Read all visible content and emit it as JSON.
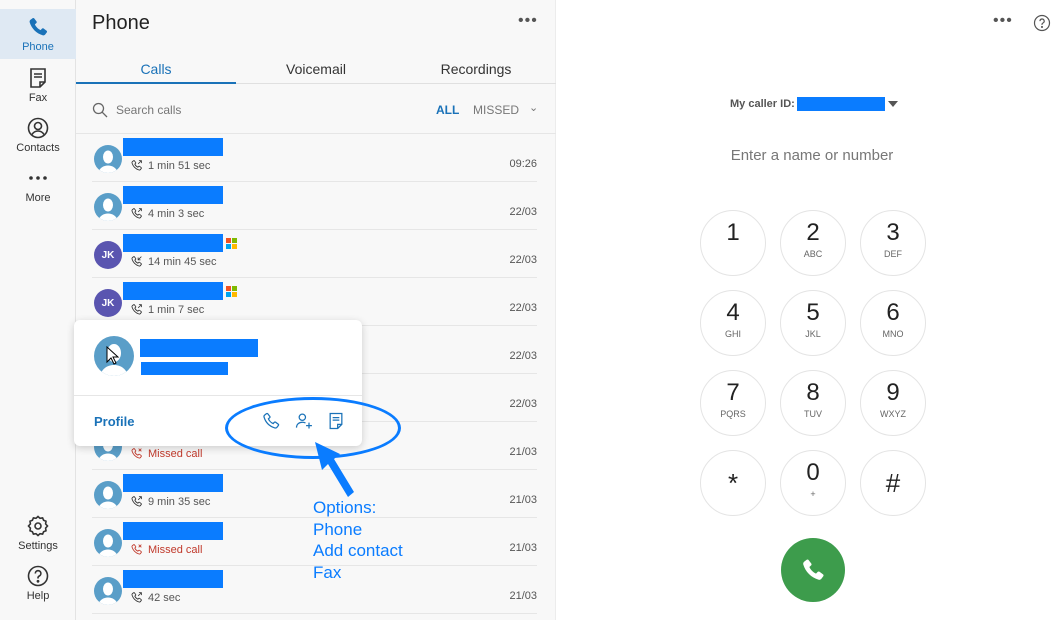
{
  "sidebar": {
    "items": [
      {
        "label": "Phone",
        "icon": "phone-icon",
        "active": true
      },
      {
        "label": "Fax",
        "icon": "fax-icon"
      },
      {
        "label": "Contacts",
        "icon": "contacts-icon"
      },
      {
        "label": "More",
        "icon": "more-icon"
      }
    ],
    "bottom_items": [
      {
        "label": "Settings",
        "icon": "gear-icon"
      },
      {
        "label": "Help",
        "icon": "help-icon"
      }
    ]
  },
  "panel": {
    "title": "Phone",
    "more_label": "•••",
    "tabs": [
      {
        "label": "Calls",
        "active": true
      },
      {
        "label": "Voicemail"
      },
      {
        "label": "Recordings"
      }
    ],
    "search": {
      "placeholder": "Search calls",
      "value": ""
    },
    "filters": {
      "all": "ALL",
      "missed": "MISSED",
      "chevron": "⌄"
    },
    "calls": [
      {
        "avatar": "generic",
        "direction": "outgoing",
        "meta": "1 min 51 sec",
        "time": "09:26"
      },
      {
        "avatar": "generic",
        "direction": "outgoing",
        "meta": "4 min 3 sec",
        "time": "22/03"
      },
      {
        "avatar": "initials",
        "initials": "JK",
        "ms_badge": true,
        "direction": "incoming",
        "meta": "14 min 45 sec",
        "time": "22/03"
      },
      {
        "avatar": "initials",
        "initials": "JK",
        "ms_badge": true,
        "direction": "outgoing",
        "meta": "1 min 7 sec",
        "time": "22/03"
      },
      {
        "avatar": "generic",
        "direction": "outgoing",
        "meta": "",
        "time": "22/03"
      },
      {
        "avatar": "generic",
        "direction": "outgoing",
        "meta": "",
        "time": "22/03"
      },
      {
        "avatar": "generic",
        "direction": "missed",
        "meta": "Missed call",
        "time": "21/03"
      },
      {
        "avatar": "generic",
        "direction": "outgoing",
        "meta": "9 min 35 sec",
        "time": "21/03"
      },
      {
        "avatar": "generic",
        "direction": "missed",
        "meta": "Missed call",
        "time": "21/03"
      },
      {
        "avatar": "generic",
        "direction": "outgoing",
        "meta": "42 sec",
        "time": "21/03"
      }
    ]
  },
  "popover": {
    "profile_label": "Profile",
    "actions": [
      "phone-icon",
      "add-contact-icon",
      "fax-icon"
    ]
  },
  "annotation": {
    "lines": [
      "Options:",
      "Phone",
      "Add contact",
      "Fax"
    ],
    "color": "#0a7cff"
  },
  "dialer": {
    "more_label": "•••",
    "caller_id_label": "My caller ID:",
    "input": {
      "placeholder": "Enter a name or number",
      "value": ""
    },
    "keys": [
      {
        "digit": "1",
        "letters": ""
      },
      {
        "digit": "2",
        "letters": "ABC"
      },
      {
        "digit": "3",
        "letters": "DEF"
      },
      {
        "digit": "4",
        "letters": "GHI"
      },
      {
        "digit": "5",
        "letters": "JKL"
      },
      {
        "digit": "6",
        "letters": "MNO"
      },
      {
        "digit": "7",
        "letters": "PQRS"
      },
      {
        "digit": "8",
        "letters": "TUV"
      },
      {
        "digit": "9",
        "letters": "WXYZ"
      },
      {
        "digit": "*",
        "letters": ""
      },
      {
        "digit": "0",
        "letters": "+"
      },
      {
        "digit": "#",
        "letters": ""
      }
    ],
    "call_button_color": "#3d9c4c"
  },
  "colors": {
    "accent": "#1a72b8",
    "redaction": "#0a7cff",
    "missed": "#c0392b",
    "initials_avatar": "#5a55b0",
    "generic_avatar": "#5a9ec8"
  }
}
